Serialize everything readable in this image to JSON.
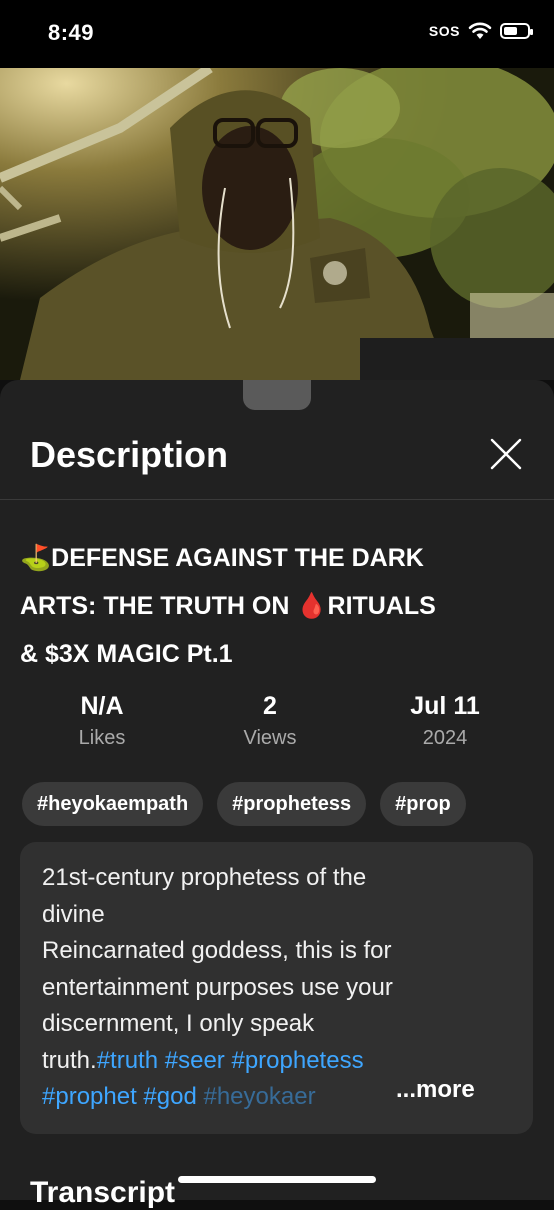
{
  "status_bar": {
    "time": "8:49",
    "cellular": "SOS",
    "icons": [
      "wifi-icon",
      "battery-icon"
    ],
    "battery_level": 0.6
  },
  "video": {
    "thumbnail": "person-in-hoodie-outdoors-night"
  },
  "description_sheet": {
    "title": "Description",
    "close_icon": "close-icon",
    "video_title": {
      "line1_prefix_emoji": "⛳",
      "line1": "DEFENSE AGAINST THE DARK",
      "line2_a": "ARTS: THE TRUTH ON ",
      "line2_emoji": "🩸",
      "line2_b": "RITUALS",
      "line3": "& $3X MAGIC Pt.1"
    },
    "stats": [
      {
        "value": "N/A",
        "label": "Likes"
      },
      {
        "value": "2",
        "label": "Views"
      },
      {
        "value": "Jul 11",
        "label": "2024"
      }
    ],
    "hashtags": [
      "#heyokaempath",
      "#prophetess",
      "#prop"
    ],
    "description": {
      "line1": "21st-century prophetess of the",
      "line2": "divine",
      "line3": "Reincarnated goddess, this is for",
      "line4": "entertainment purposes use your",
      "line5": "discernment, I only speak",
      "line6_text": "truth.",
      "line6_tags": [
        "#truth",
        "#seer",
        "#prophetess"
      ],
      "line7_tags": [
        "#prophet",
        "#god"
      ],
      "line7_faded": "#heyokaer",
      "more": "...more"
    },
    "next_section": "Transcript"
  },
  "colors": {
    "background": "#0f0f0f",
    "sheet": "#212121",
    "chip": "#3a3a3a",
    "description_box": "#303030",
    "link": "#3ea6ff",
    "muted": "#aaaaaa"
  }
}
